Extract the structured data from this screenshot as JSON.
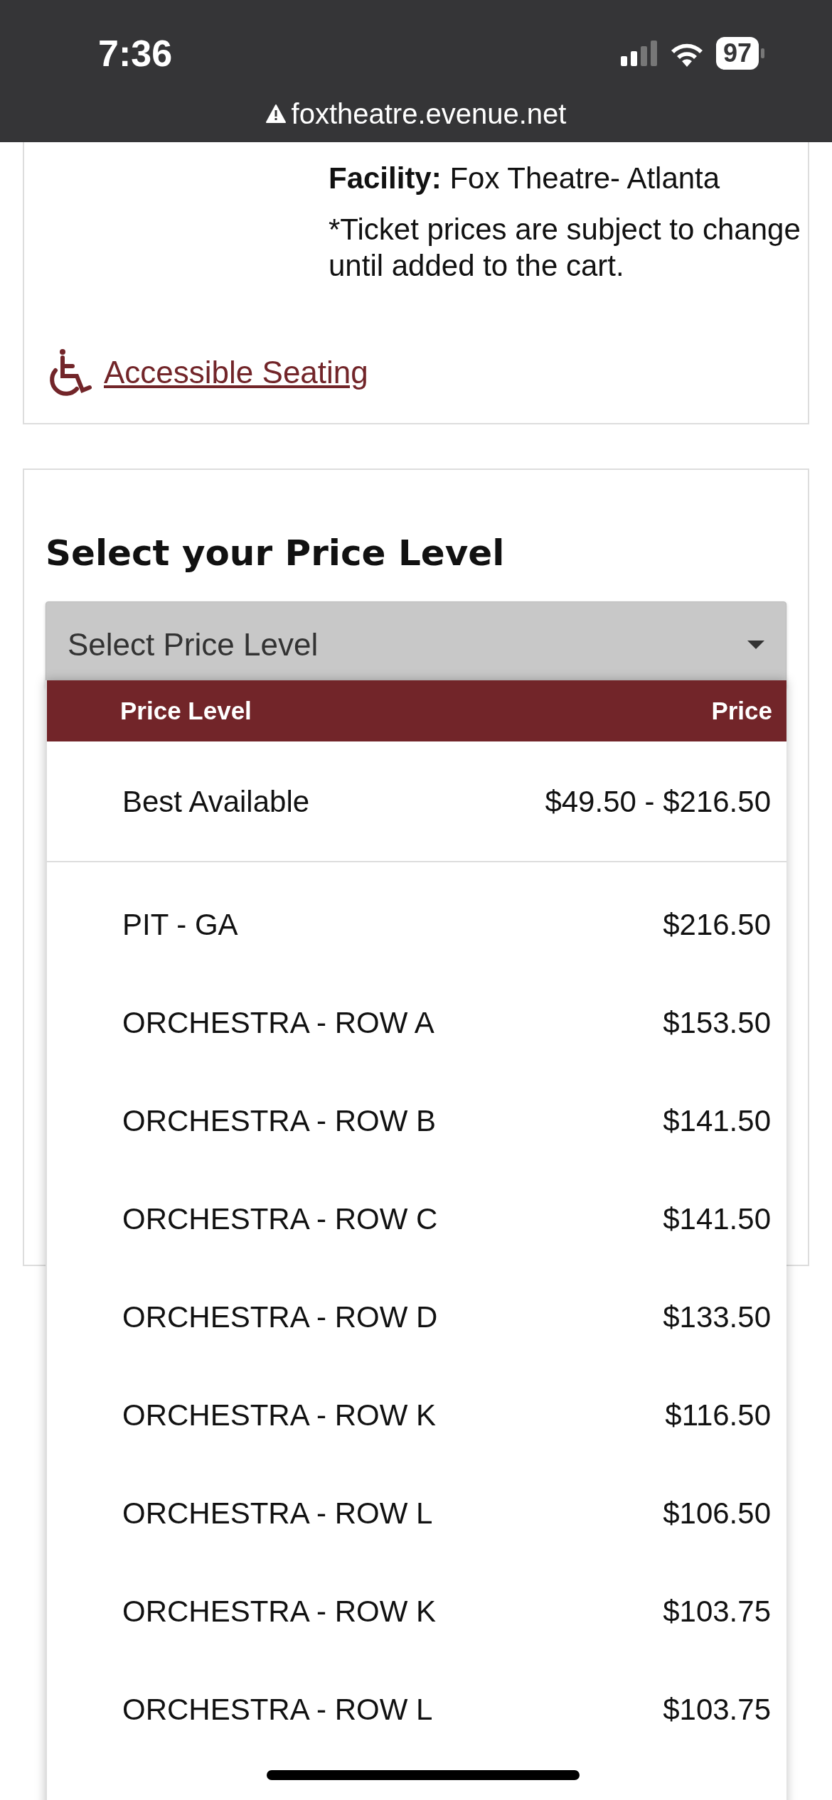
{
  "status_bar": {
    "time": "7:36",
    "battery": "97"
  },
  "address_bar": {
    "url": "foxtheatre.evenue.net"
  },
  "event_card": {
    "facility": "**Facility:** Fox Theatre- Atlanta",
    "note": "*Ticket prices are subject to change until added to the cart.",
    "accessible_link": "Accessible Seating"
  },
  "price_card": {
    "title": "Select your Price Level",
    "select": {
      "placeholder": "Select Price Level",
      "expanded": true
    }
  },
  "dropdown": {
    "columns": [
      "Price Level",
      "Price"
    ],
    "rows": [
      {
        "kind": "best",
        "level": "Best Available",
        "price": "$49.50 - $216.50"
      },
      {
        "kind": "level",
        "level": "PIT - GA",
        "price": "$216.50"
      },
      {
        "kind": "level",
        "level": "ORCHESTRA - ROW A",
        "price": "$153.50"
      },
      {
        "kind": "level",
        "level": "ORCHESTRA - ROW B",
        "price": "$141.50"
      },
      {
        "kind": "level",
        "level": "ORCHESTRA - ROW C",
        "price": "$141.50"
      },
      {
        "kind": "level",
        "level": "ORCHESTRA - ROW D",
        "price": "$133.50"
      },
      {
        "kind": "level",
        "level": "ORCHESTRA - ROW K",
        "price": "$116.50"
      },
      {
        "kind": "level",
        "level": "ORCHESTRA - ROW L",
        "price": "$106.50"
      },
      {
        "kind": "level",
        "level": "ORCHESTRA - ROW K",
        "price": "$103.75"
      },
      {
        "kind": "level",
        "level": "ORCHESTRA - ROW L",
        "price": "$103.75"
      }
    ]
  }
}
